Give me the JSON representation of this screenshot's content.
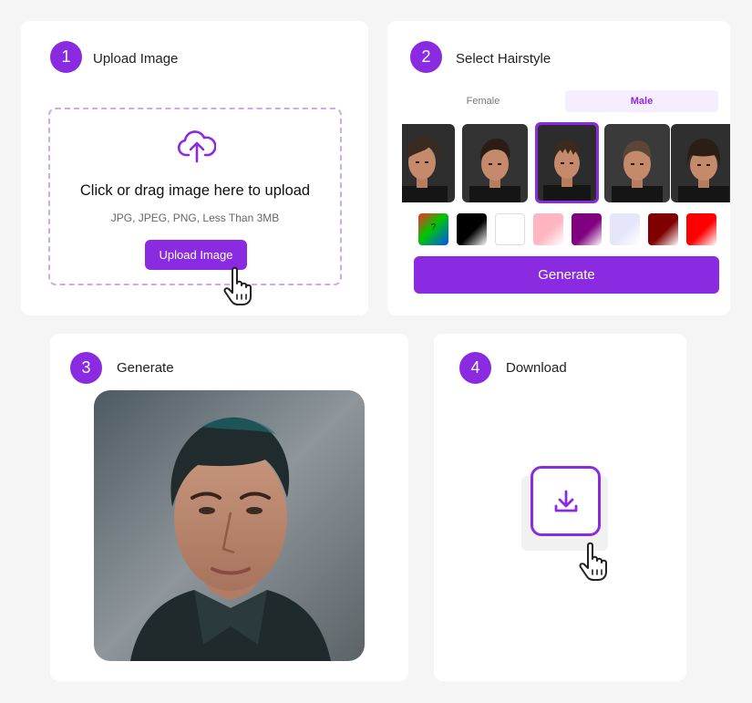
{
  "accent_color": "#8a2be2",
  "steps": [
    {
      "number": "1",
      "title": "Upload Image"
    },
    {
      "number": "2",
      "title": "Select Hairstyle"
    },
    {
      "number": "3",
      "title": "Generate"
    },
    {
      "number": "4",
      "title": "Download"
    }
  ],
  "upload": {
    "icon": "cloud-upload-icon",
    "main_text": "Click or drag image here to upload",
    "sub_text": "JPG, JPEG, PNG, Less Than 3MB",
    "button_label": "Upload Image"
  },
  "hairstyle": {
    "tabs": [
      {
        "label": "Female",
        "selected": false
      },
      {
        "label": "Male",
        "selected": true
      }
    ],
    "thumbnails": [
      {
        "style": "textured-quiff",
        "selected": false
      },
      {
        "style": "slick-pompadour",
        "selected": false
      },
      {
        "style": "spiky-fringe",
        "selected": true
      },
      {
        "style": "side-part",
        "selected": false
      },
      {
        "style": "bowl-fringe",
        "selected": false
      }
    ],
    "color_swatches": [
      {
        "name": "random",
        "label": "?",
        "colors": [
          "#ff2a2a",
          "#00c600",
          "#0050ff"
        ]
      },
      {
        "name": "black",
        "colors": [
          "#000000",
          "#ffffff"
        ]
      },
      {
        "name": "white",
        "colors": [
          "#ffffff",
          "#ffffff"
        ]
      },
      {
        "name": "pink",
        "colors": [
          "#ffb6c1",
          "#ffffff"
        ]
      },
      {
        "name": "purple",
        "colors": [
          "#800080",
          "#ffffff"
        ]
      },
      {
        "name": "lavender",
        "colors": [
          "#e6e6fa",
          "#ffffff"
        ]
      },
      {
        "name": "maroon",
        "colors": [
          "#800000",
          "#ffffff"
        ]
      },
      {
        "name": "red",
        "colors": [
          "#ff0000",
          "#ffffff"
        ]
      }
    ],
    "generate_label": "Generate"
  },
  "download": {
    "icon": "download-icon"
  }
}
